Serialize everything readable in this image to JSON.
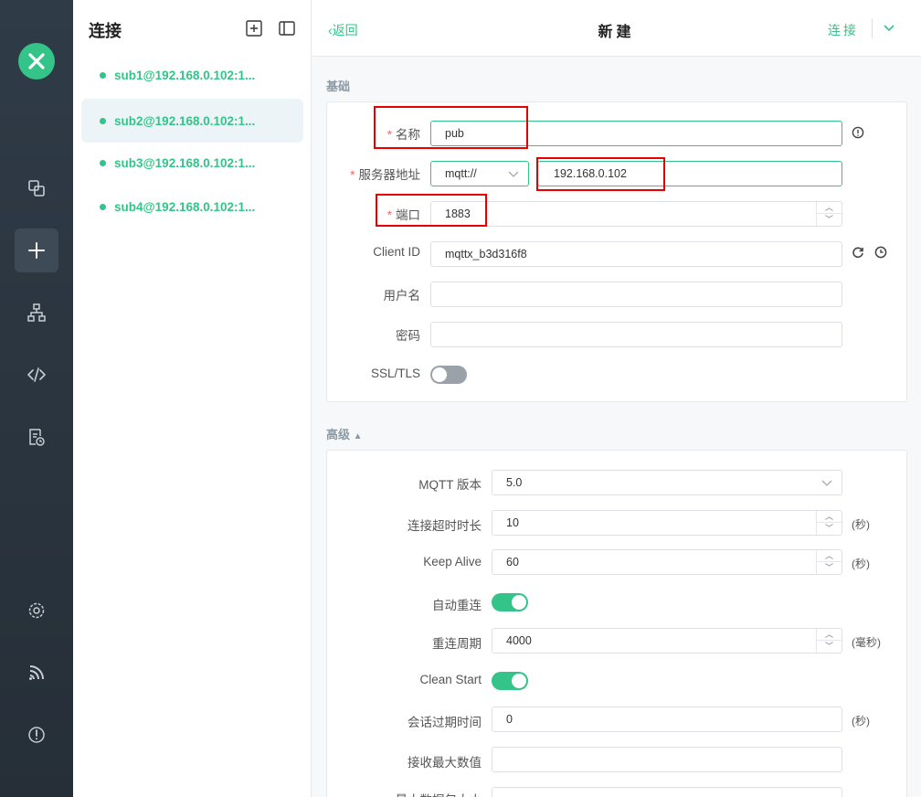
{
  "sidebar": {
    "nav": [
      "connections-icon",
      "new-connection-icon",
      "topology-icon",
      "script-icon",
      "log-icon",
      "settings-icon",
      "subscription-icon",
      "about-icon"
    ]
  },
  "connections": {
    "title": "连接",
    "items": [
      {
        "name": "sub1@192.168.0.102:1..."
      },
      {
        "name": "sub2@192.168.0.102:1..."
      },
      {
        "name": "sub3@192.168.0.102:1..."
      },
      {
        "name": "sub4@192.168.0.102:1..."
      }
    ]
  },
  "topbar": {
    "back": "返回",
    "title": "新建",
    "connect": "连接"
  },
  "basic": {
    "section": "基础",
    "name_label": "名称",
    "name_value": "pub",
    "host_label": "服务器地址",
    "protocol": "mqtt://",
    "host_value": "192.168.0.102",
    "port_label": "端口",
    "port_value": "1883",
    "clientid_label": "Client ID",
    "clientid_value": "mqttx_b3d316f8",
    "username_label": "用户名",
    "username_value": "",
    "password_label": "密码",
    "password_value": "",
    "ssl_label": "SSL/TLS"
  },
  "advanced": {
    "section": "高级",
    "mqtt_version_label": "MQTT 版本",
    "mqtt_version_value": "5.0",
    "timeout_label": "连接超时时长",
    "timeout_value": "10",
    "timeout_unit": "(秒)",
    "keepalive_label": "Keep Alive",
    "keepalive_value": "60",
    "keepalive_unit": "(秒)",
    "reconnect_label": "自动重连",
    "reconnect_period_label": "重连周期",
    "reconnect_period_value": "4000",
    "reconnect_period_unit": "(毫秒)",
    "clean_start_label": "Clean Start",
    "session_expiry_label": "会话过期时间",
    "session_expiry_value": "0",
    "session_expiry_unit": "(秒)",
    "receive_max_label": "接收最大数值",
    "receive_max_value": "",
    "max_packet_label": "最大数据包大小"
  },
  "colors": {
    "accent": "#34c388",
    "rail": "#2f3b47",
    "required": "#f56c6c",
    "highlight": "#e60000"
  }
}
